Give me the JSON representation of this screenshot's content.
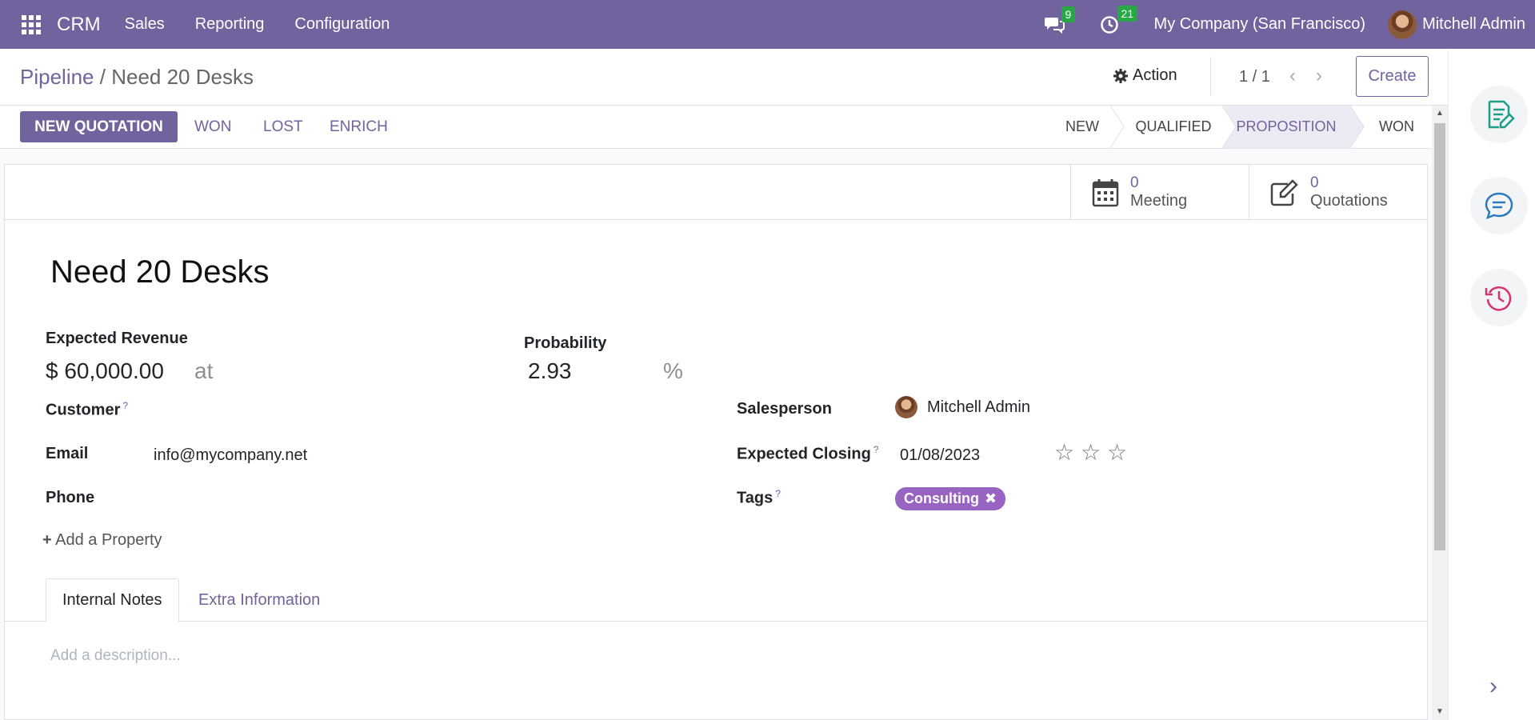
{
  "navbar": {
    "brand": "CRM",
    "menus": [
      "Sales",
      "Reporting",
      "Configuration"
    ],
    "messages_count": "9",
    "activities_count": "21",
    "company": "My Company (San Francisco)",
    "user": "Mitchell Admin",
    "icons": [
      "apps-grid-icon",
      "chat-icon",
      "clock-icon"
    ]
  },
  "control": {
    "breadcrumb_parent": "Pipeline",
    "breadcrumb_sep": "/",
    "breadcrumb_current": "Need 20 Desks",
    "action_label": "Action",
    "pager": "1 / 1",
    "create_label": "Create"
  },
  "statusbar": {
    "buttons": [
      "NEW QUOTATION",
      "WON",
      "LOST",
      "ENRICH"
    ],
    "stages": [
      "NEW",
      "QUALIFIED",
      "PROPOSITION",
      "WON"
    ],
    "current_stage": "PROPOSITION"
  },
  "smart_buttons": [
    {
      "count": "0",
      "label": "Meeting",
      "icon": "calendar-icon"
    },
    {
      "count": "0",
      "label": "Quotations",
      "icon": "edit-icon"
    }
  ],
  "form": {
    "title": "Need 20 Desks",
    "expected_revenue_label": "Expected Revenue",
    "expected_revenue": "$ 60,000.00",
    "at": "at",
    "probability_label": "Probability",
    "probability": "2.93",
    "percent": "%",
    "customer_label": "Customer",
    "help_mark": "?",
    "email_label": "Email",
    "email": "info@mycompany.net",
    "phone_label": "Phone",
    "salesperson_label": "Salesperson",
    "salesperson": "Mitchell Admin",
    "expected_closing_label": "Expected Closing",
    "expected_closing": "01/08/2023",
    "priority_stars": 0,
    "tags_label": "Tags",
    "tag": "Consulting",
    "add_property": "Add a Property"
  },
  "tabs": [
    "Internal Notes",
    "Extra Information"
  ],
  "description_placeholder": "Add a description...",
  "colors": {
    "brand": "#71639e",
    "tag": "#9864c2",
    "badge": "#28a745"
  }
}
